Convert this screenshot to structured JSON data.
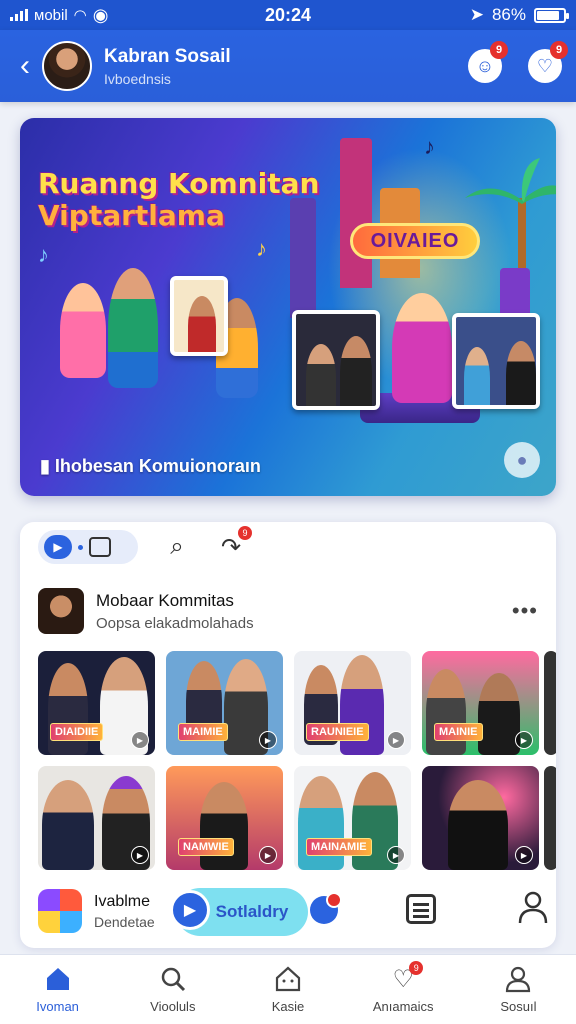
{
  "status_bar": {
    "carrier": "ᴍobil",
    "time": "20:24",
    "battery": "86%",
    "battery_level": 0.86
  },
  "header": {
    "title": "Kabran Sosail",
    "subtitle": "Ivboednsis",
    "back_icon": "chevron-left-icon",
    "notif_badge_1": "9",
    "notif_badge_2": "9"
  },
  "banner": {
    "title_line1": "Ruanng Komnitan",
    "title_line2": "Viptartlama",
    "stage_sign": "OIVAIEO",
    "caption": "Ihobesan Komuionoraın",
    "colors": {
      "bg_start": "#2b2ea8",
      "bg_end": "#3da5c9",
      "title": "#ffe04a"
    }
  },
  "feed": {
    "toolbar_badge": "9",
    "post": {
      "title": "Mobaar Kommitas",
      "subtitle": "Oopsa elakadmolahads",
      "more": "•••"
    },
    "tiles": [
      {
        "label": "DIAIDIIE",
        "bg": "#1b1f3a"
      },
      {
        "label": "MAIMIE",
        "bg": "#6ea6d6"
      },
      {
        "label": "RAUNIEIE",
        "bg": "#eef0f4"
      },
      {
        "label": "MAINIE",
        "bg": "#2bbf6a"
      },
      {
        "label": "",
        "bg": "#333"
      },
      {
        "label": "",
        "bg": "#e8e6e2"
      },
      {
        "label": "NAMWIE",
        "bg": "#b43a6a"
      },
      {
        "label": "MAINAMIE",
        "bg": "#f2f3f5"
      },
      {
        "label": "",
        "bg": "#2a1b3a"
      },
      {
        "label": "",
        "bg": "#333"
      }
    ],
    "mini": {
      "title": "Ivablme",
      "subtitle": "Dendetae",
      "action_label": "Sotlaldry"
    }
  },
  "bottom_nav": [
    {
      "label": "Ivoman",
      "icon": "home-icon",
      "active": true
    },
    {
      "label": "Viooluls",
      "icon": "search-icon",
      "active": false
    },
    {
      "label": "Kasie",
      "icon": "house-face-icon",
      "active": false
    },
    {
      "label": "Anıamaics",
      "icon": "heart-icon",
      "active": false,
      "badge": "9"
    },
    {
      "label": "Sosuıl",
      "icon": "user-icon",
      "active": false
    }
  ]
}
